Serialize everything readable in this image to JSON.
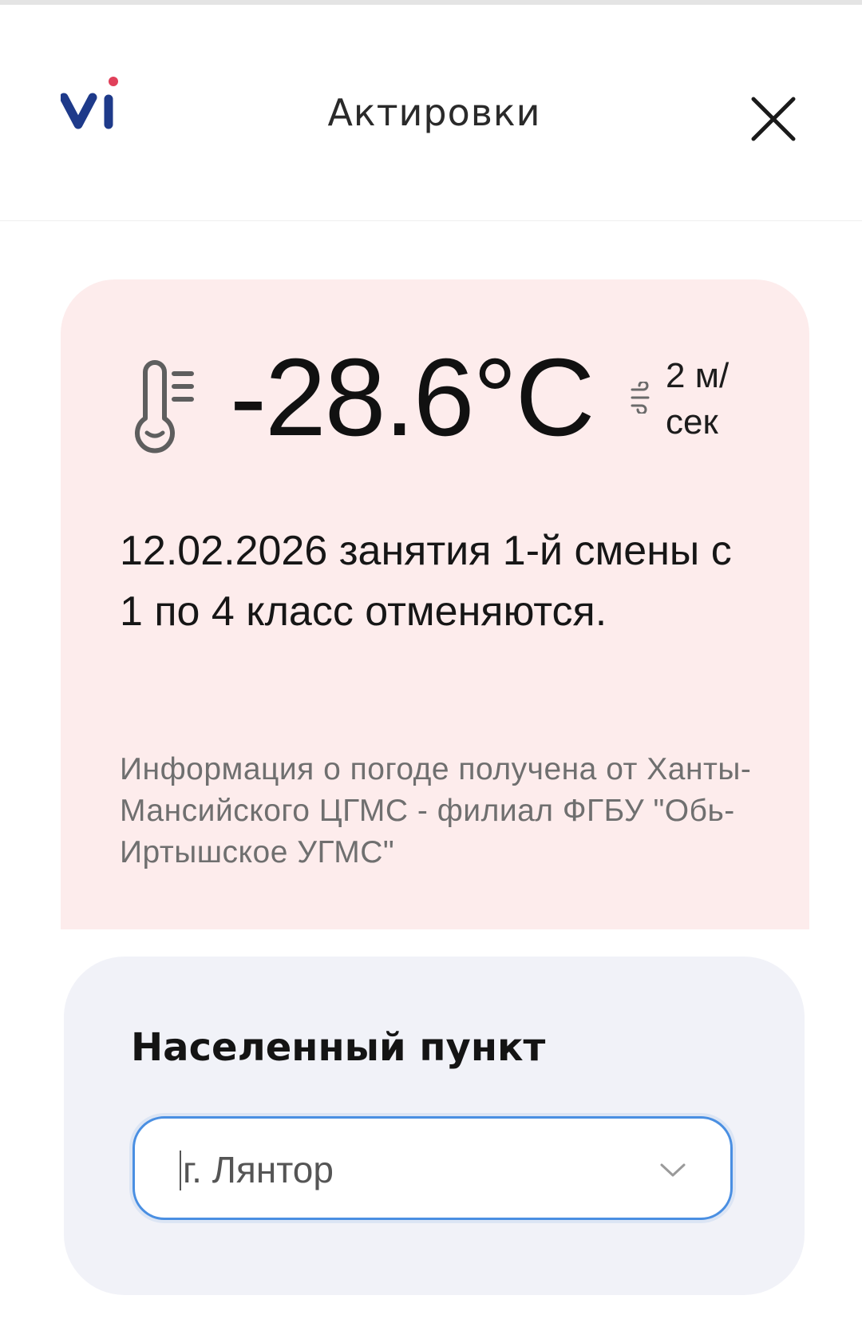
{
  "header": {
    "logo_text": "vi",
    "title": "Актировки",
    "close_icon": "close-icon"
  },
  "weather": {
    "temperature": "-28.6°C",
    "wind_speed": "2 м/сек",
    "thermometer_icon": "thermometer-icon",
    "wind_icon": "wind-icon",
    "notice": "12.02.2026 занятия 1-й смены с 1 по 4 класс отменяются.",
    "source": "Информация о погоде получена от Ханты-Мансийского ЦГМС - филиал ФГБУ \"Обь-Иртышское УГМС\"",
    "card_color": "#fdecec"
  },
  "location": {
    "label": "Населенный пункт",
    "selected_value": "г. Лянтор",
    "dropdown_icon": "chevron-down-icon",
    "card_color": "#f1f2f8",
    "focus_color": "#4a8fe2"
  },
  "colors": {
    "brand_blue": "#1e3a8a",
    "brand_red": "#e0405a"
  }
}
